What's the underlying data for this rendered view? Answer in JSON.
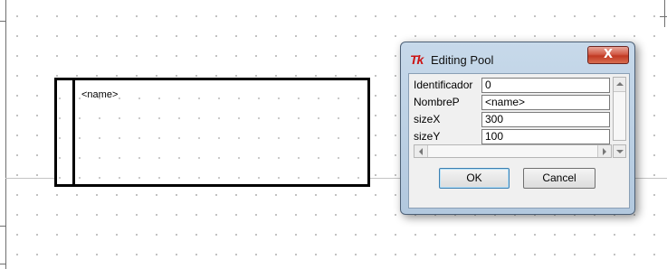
{
  "canvas": {
    "grid": "dotted"
  },
  "pool": {
    "name_label": "<name>"
  },
  "dialog": {
    "title": "Editing Pool",
    "app_icon": "Tk",
    "close_glyph": "X",
    "fields": [
      {
        "label": "Identificador",
        "value": "0"
      },
      {
        "label": "NombreP",
        "value": "<name>"
      },
      {
        "label": "sizeX",
        "value": "300"
      },
      {
        "label": "sizeY",
        "value": "100"
      }
    ],
    "ok_label": "OK",
    "cancel_label": "Cancel"
  },
  "colors": {
    "accent_close": "#c13923",
    "icon_red": "#cc1414",
    "frame": "#b9cde2"
  }
}
